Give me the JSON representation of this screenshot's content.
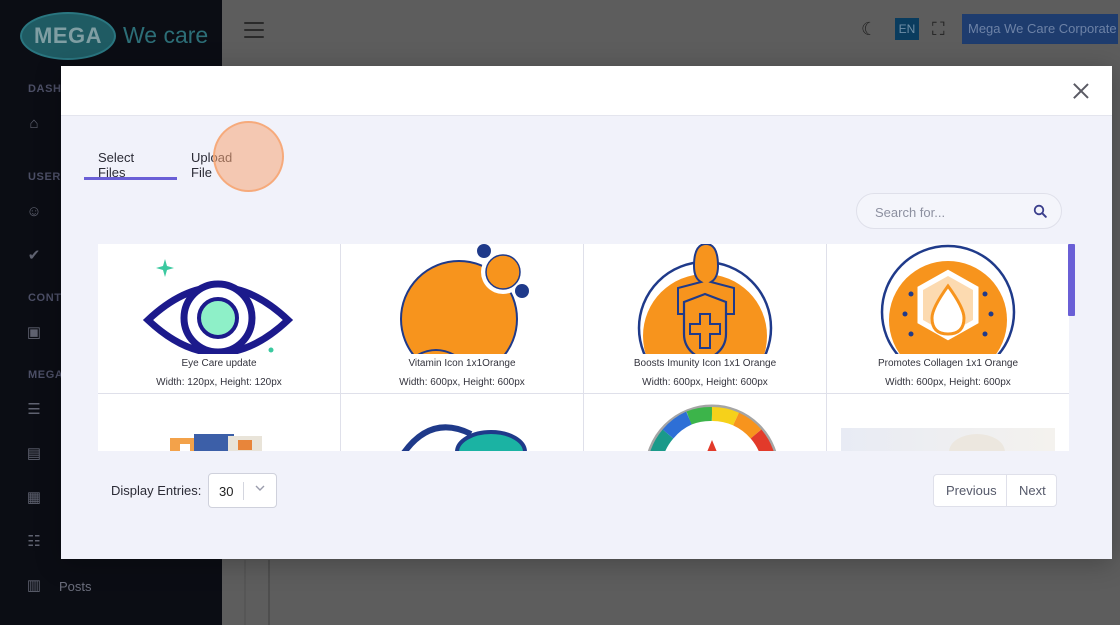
{
  "app": {
    "logo_mark": "MEGA",
    "logo_text": "We care",
    "sidebar": {
      "sections": [
        "DASH",
        "USER",
        "CONT",
        "MEGA"
      ],
      "posts_label": "Posts"
    },
    "topbar": {
      "language": "EN",
      "account": "Mega We Care Corporate"
    }
  },
  "modal": {
    "tabs": [
      {
        "label": "Select Files",
        "active": true
      },
      {
        "label": "Upload File",
        "active": false
      }
    ],
    "search": {
      "placeholder": "Search for..."
    },
    "files": [
      {
        "name": "Eye Care update",
        "dims": "Width: 120px, Height: 120px"
      },
      {
        "name": "Vitamin Icon 1x1Orange",
        "dims": "Width: 600px, Height: 600px"
      },
      {
        "name": "Boosts Imunity Icon 1x1 Orange",
        "dims": "Width: 600px, Height: 600px"
      },
      {
        "name": "Promotes Collagen 1x1 Orange",
        "dims": "Width: 600px, Height: 600px"
      }
    ],
    "entries": {
      "label": "Display Entries:",
      "value": "30"
    },
    "pagination": {
      "previous": "Previous",
      "next": "Next"
    }
  },
  "colors": {
    "accent": "#6a5fd6",
    "orange": "#f7941d",
    "navy": "#1f3a8a"
  }
}
